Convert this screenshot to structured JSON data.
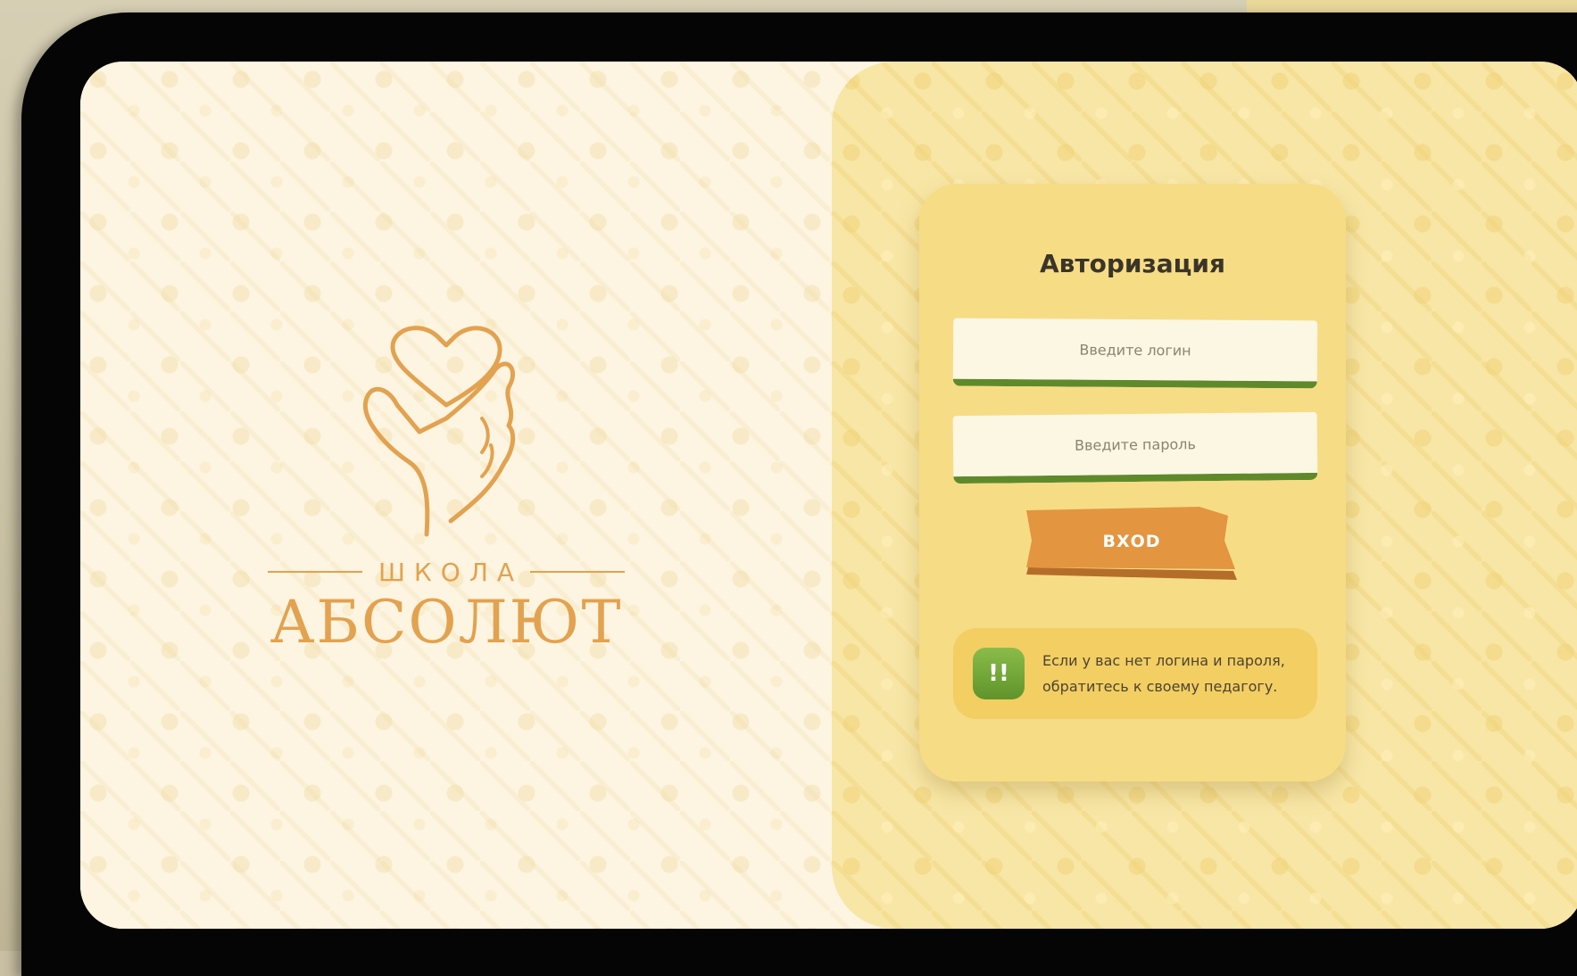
{
  "logo": {
    "school_label": "ШКОЛА",
    "name": "АБСОЛЮТ"
  },
  "auth": {
    "title": "Авторизация",
    "login_placeholder": "Введите логин",
    "password_placeholder": "Введите пароль",
    "submit_label": "ВХОD",
    "notice_icon": "!!",
    "notice_text_line1": "Если у вас нет логина и пароля,",
    "notice_text_line2": "обратитесь к своему педагогу."
  },
  "colors": {
    "accent_orange": "#e3a24f",
    "button_orange": "#e3953f",
    "input_border_green": "#5f8a2c",
    "card_yellow": "#f7dc86",
    "notice_yellow": "#f3ce63"
  },
  "icons": {
    "logo_mark": "heart-in-hand-icon",
    "notice": "exclamation-icon"
  }
}
